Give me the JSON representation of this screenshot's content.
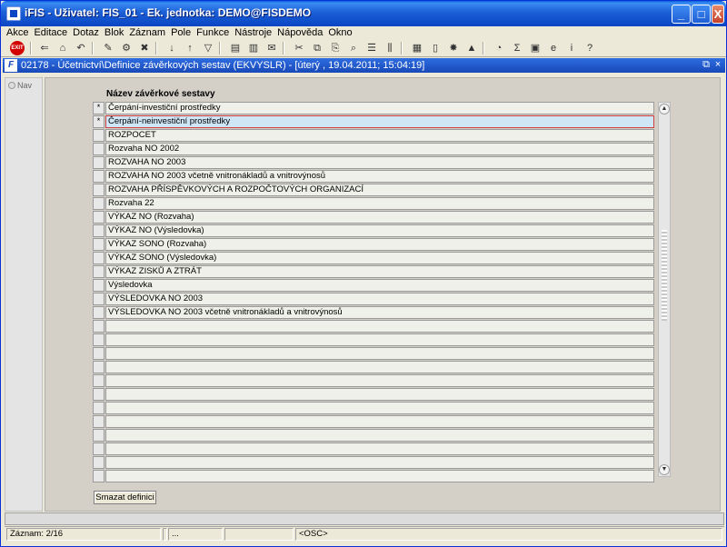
{
  "window": {
    "title": "iFIS - Uživatel: FIS_01 - Ek. jednotka: DEMO@FISDEMO",
    "minimize_glyph": "_",
    "maximize_glyph": "□",
    "close_glyph": "X"
  },
  "menu": [
    "Akce",
    "Editace",
    "Dotaz",
    "Blok",
    "Záznam",
    "Pole",
    "Funkce",
    "Nástroje",
    "Nápověda",
    "Okno"
  ],
  "toolbar": {
    "exit_label": "EXIT",
    "help_glyph": "?"
  },
  "form_window": {
    "title": "02178 - Účetnictví\\Definice závěrkových sestav (EKVYSLR) - [úterý  , 19.04.2011; 15:04:19]",
    "icon_letter": "F"
  },
  "nav": {
    "label": "Nav"
  },
  "grid": {
    "column_header": "Název závěrkové sestavy",
    "rows": [
      {
        "marker": "*",
        "name": "Čerpání-investiční prostředky"
      },
      {
        "marker": "*",
        "name": "Čerpání-neinvestiční prostředky"
      },
      {
        "marker": "",
        "name": "ROZPOCET"
      },
      {
        "marker": "",
        "name": "Rozvaha NO 2002"
      },
      {
        "marker": "",
        "name": "ROZVAHA NO 2003"
      },
      {
        "marker": "",
        "name": "ROZVAHA NO 2003 včetně vnitronákladů a vnitrovýnosů"
      },
      {
        "marker": "",
        "name": "ROZVAHA PŘÍSPĚVKOVÝCH A ROZPOČTOVÝCH ORGANIZACÍ"
      },
      {
        "marker": "",
        "name": "Rozvaha 22"
      },
      {
        "marker": "",
        "name": "VÝKAZ NO (Rozvaha)"
      },
      {
        "marker": "",
        "name": "VÝKAZ NO (Výsledovka)"
      },
      {
        "marker": "",
        "name": "VÝKAZ SONO (Rozvaha)"
      },
      {
        "marker": "",
        "name": "VÝKAZ SONO (Výsledovka)"
      },
      {
        "marker": "",
        "name": "VÝKAZ ZISKŮ A ZTRÁT"
      },
      {
        "marker": "",
        "name": "Výsledovka"
      },
      {
        "marker": "",
        "name": "VÝSLEDOVKA NO 2003"
      },
      {
        "marker": "",
        "name": "VÝSLEDOVKA NO 2003 včetně vnitronákladů a vnitrovýnosů"
      },
      {
        "marker": "",
        "name": ""
      },
      {
        "marker": "",
        "name": ""
      },
      {
        "marker": "",
        "name": ""
      },
      {
        "marker": "",
        "name": ""
      },
      {
        "marker": "",
        "name": ""
      },
      {
        "marker": "",
        "name": ""
      },
      {
        "marker": "",
        "name": ""
      },
      {
        "marker": "",
        "name": ""
      },
      {
        "marker": "",
        "name": ""
      },
      {
        "marker": "",
        "name": ""
      },
      {
        "marker": "",
        "name": ""
      },
      {
        "marker": "",
        "name": ""
      }
    ],
    "current_row": 2
  },
  "buttons": {
    "delete_definition": "Smazat definici"
  },
  "statusbar": {
    "record": "Záznam: 2/16",
    "segment_2": "",
    "segment_3": "...",
    "segment_4": "",
    "mode": "<OSC>"
  }
}
